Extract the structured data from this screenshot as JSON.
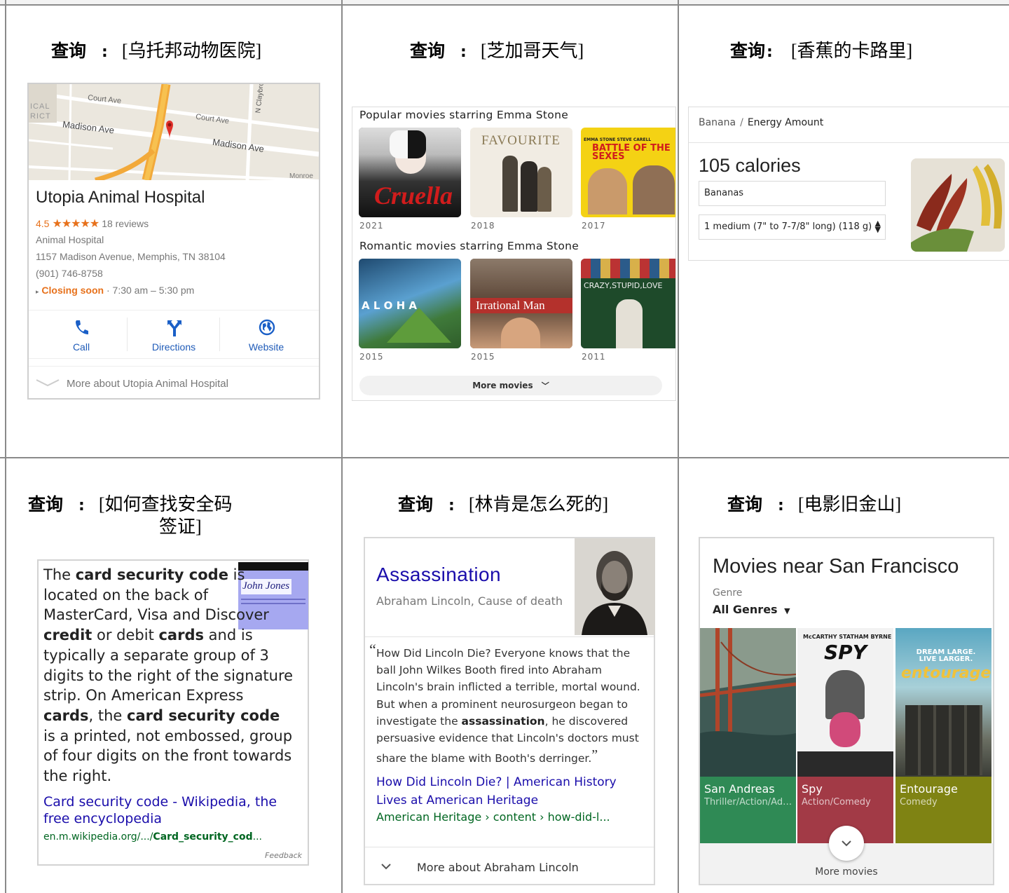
{
  "queries": [
    {
      "label": "查询",
      "sep": ":",
      "text": "[乌托邦动物医院]"
    },
    {
      "label": "查询",
      "sep": ":",
      "text": "[芝加哥天气]"
    },
    {
      "label": "查询",
      "sep": ":",
      "text": "[香蕉的卡路里]"
    },
    {
      "label": "查询",
      "sep": ":",
      "text": "[如何查找安全码",
      "text2": "签证]"
    },
    {
      "label": "查询",
      "sep": ":",
      "text": "[林肯是怎么死的]"
    },
    {
      "label": "查询",
      "sep": ":",
      "text": "[电影旧金山]"
    }
  ],
  "hospital": {
    "map_labels": {
      "court_ave_1": "Court Ave",
      "court_ave_2": "Court Ave",
      "madison_1": "Madison Ave",
      "madison_2": "Madison Ave",
      "claybrook": "N Claybrc",
      "ical": "ICAL",
      "rict": "RICT",
      "monroe": "Monroe"
    },
    "name": "Utopia Animal Hospital",
    "rating": "4.5",
    "stars": "★★★★★",
    "reviews": "18 reviews",
    "category": "Animal Hospital",
    "address": "1157 Madison Avenue, Memphis, TN 38104",
    "phone": "(901) 746-8758",
    "status": "Closing soon",
    "hours": "· 7:30 am – 5:30 pm",
    "actions": {
      "call": "Call",
      "directions": "Directions",
      "website": "Website"
    },
    "more": "More about Utopia Animal Hospital"
  },
  "movies": {
    "section1": "Popular movies starring Emma Stone",
    "section2": "Romantic movies starring Emma Stone",
    "row1": [
      {
        "poster_text": "Cruella",
        "year": "2021"
      },
      {
        "poster_text": "FAVOURITE",
        "year": "2018"
      },
      {
        "poster_text": "BATTLE OF THE SEXES",
        "poster_top": "EMMA STONE   STEVE CARELL",
        "year": "2017"
      }
    ],
    "row2": [
      {
        "poster_text": "A L O H A",
        "year": "2015"
      },
      {
        "poster_text": "Irrational Man",
        "year": "2015"
      },
      {
        "poster_text": "CRAZY,STUPID,LOVE",
        "year": "2011"
      }
    ],
    "more": "More movies"
  },
  "banana": {
    "crumb_1": "Banana",
    "crumb_sep": "/",
    "crumb_2": "Energy Amount",
    "calories": "105 calories",
    "food": "Bananas",
    "serving": "1 medium (7\" to 7-7/8\" long) (118 g)"
  },
  "security": {
    "text_runs": [
      {
        "t": "The ",
        "b": false
      },
      {
        "t": "card security code",
        "b": true
      },
      {
        "t": " is located on the back of MasterCard, Visa and Discover ",
        "b": false
      },
      {
        "t": "credit",
        "b": true
      },
      {
        "t": " or debit ",
        "b": false
      },
      {
        "t": "cards",
        "b": true
      },
      {
        "t": " and is typically a separate group of 3 digits to the right of the signature strip. On American Express ",
        "b": false
      },
      {
        "t": "cards",
        "b": true
      },
      {
        "t": ", the ",
        "b": false
      },
      {
        "t": "card security code",
        "b": true
      },
      {
        "t": " is a printed, not embossed, group of four digits on the front towards the right.",
        "b": false
      }
    ],
    "card_signature": "John Jones",
    "link": "Card security code - Wikipedia, the free encyclopedia",
    "url_prefix": "en.m.wikipedia.org/.../",
    "url_bold": "Card_security_cod",
    "url_suffix": "...",
    "feedback": "Feedback"
  },
  "lincoln": {
    "title": "Assassination",
    "subtitle": "Abraham Lincoln, Cause of death",
    "quote_runs": [
      {
        "t": "How Did Lincoln Die? Everyone knows that the ball John Wilkes Booth fired into Abraham Lincoln's brain inflicted a terrible, mortal wound. But when a prominent neurosurgeon began to investigate the ",
        "b": false
      },
      {
        "t": "assassination",
        "b": true
      },
      {
        "t": ", he discovered persuasive evidence that Lincoln's doctors must share the blame with Booth's derringer.",
        "b": false
      }
    ],
    "link": "How Did Lincoln Die? | American History Lives at American Heritage",
    "url": "American Heritage › content › how-did-l...",
    "more": "More about Abraham Lincoln"
  },
  "sf": {
    "title": "Movies near San Francisco",
    "genre_label": "Genre",
    "genre_value": "All Genres",
    "tiles": [
      {
        "name": "San Andreas",
        "genre": "Thriller/Action/Adventure",
        "color": "#2f8a55"
      },
      {
        "name": "Spy",
        "genre": "Action/Comedy",
        "color": "#a23a46"
      },
      {
        "name": "Entourage",
        "genre": "Comedy",
        "color": "#7f8313",
        "poster_text": "entourage",
        "tagline": "DREAM LARGE. LIVE LARGER."
      }
    ],
    "spy_top": "McCARTHY  STATHAM  BYRNE  LAW",
    "spy_title": "SPY",
    "more": "More movies"
  }
}
